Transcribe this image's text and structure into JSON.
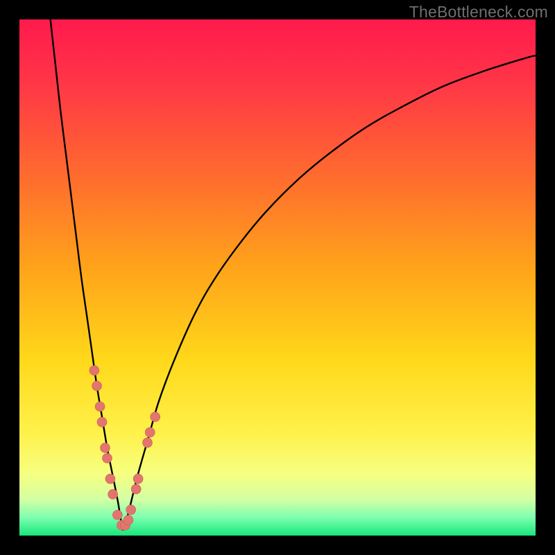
{
  "watermark": "TheBottleneck.com",
  "colors": {
    "frame_bg": "#000000",
    "curve_stroke": "#000000",
    "marker_fill": "#e2756d",
    "marker_stroke": "#c9615a"
  },
  "chart_data": {
    "type": "line",
    "title": "",
    "xlabel": "",
    "ylabel": "",
    "xlim": [
      0,
      100
    ],
    "ylim": [
      0,
      100
    ],
    "grid": false,
    "legend": false,
    "gradient_stops": [
      {
        "pos": 0.0,
        "color": "#ff1a4d"
      },
      {
        "pos": 0.12,
        "color": "#ff3547"
      },
      {
        "pos": 0.3,
        "color": "#ff6a2f"
      },
      {
        "pos": 0.48,
        "color": "#ffa31a"
      },
      {
        "pos": 0.66,
        "color": "#ffd81a"
      },
      {
        "pos": 0.8,
        "color": "#fff14a"
      },
      {
        "pos": 0.88,
        "color": "#f6ff80"
      },
      {
        "pos": 0.93,
        "color": "#d4ffa3"
      },
      {
        "pos": 0.965,
        "color": "#7dffb0"
      },
      {
        "pos": 1.0,
        "color": "#18e67a"
      }
    ],
    "series": [
      {
        "name": "left-branch",
        "x": [
          6,
          7,
          8,
          9,
          10,
          11,
          12,
          13,
          14,
          15,
          16,
          17,
          18,
          19,
          19.5,
          20
        ],
        "y": [
          100,
          91,
          82,
          74,
          66,
          58,
          50,
          43,
          36,
          29,
          23,
          17,
          12,
          7,
          4,
          1
        ]
      },
      {
        "name": "right-branch",
        "x": [
          20,
          21,
          22,
          23,
          25,
          27,
          30,
          34,
          38,
          43,
          48,
          54,
          60,
          67,
          74,
          82,
          90,
          98,
          100
        ],
        "y": [
          1,
          4,
          8,
          12,
          19,
          26,
          34,
          43,
          50,
          57,
          63,
          69,
          74,
          79,
          83,
          87,
          90,
          92.5,
          93
        ]
      }
    ],
    "markers": [
      {
        "x": 14.5,
        "y": 32
      },
      {
        "x": 15.0,
        "y": 29
      },
      {
        "x": 15.6,
        "y": 25
      },
      {
        "x": 16.0,
        "y": 22
      },
      {
        "x": 16.6,
        "y": 17
      },
      {
        "x": 17.0,
        "y": 15
      },
      {
        "x": 17.6,
        "y": 11
      },
      {
        "x": 18.1,
        "y": 8
      },
      {
        "x": 19.0,
        "y": 4
      },
      {
        "x": 19.8,
        "y": 2
      },
      {
        "x": 20.5,
        "y": 2
      },
      {
        "x": 21.1,
        "y": 3
      },
      {
        "x": 21.6,
        "y": 5
      },
      {
        "x": 22.6,
        "y": 9
      },
      {
        "x": 23.0,
        "y": 11
      },
      {
        "x": 24.8,
        "y": 18
      },
      {
        "x": 25.3,
        "y": 20
      },
      {
        "x": 26.3,
        "y": 23
      }
    ],
    "marker_radius": 7
  }
}
